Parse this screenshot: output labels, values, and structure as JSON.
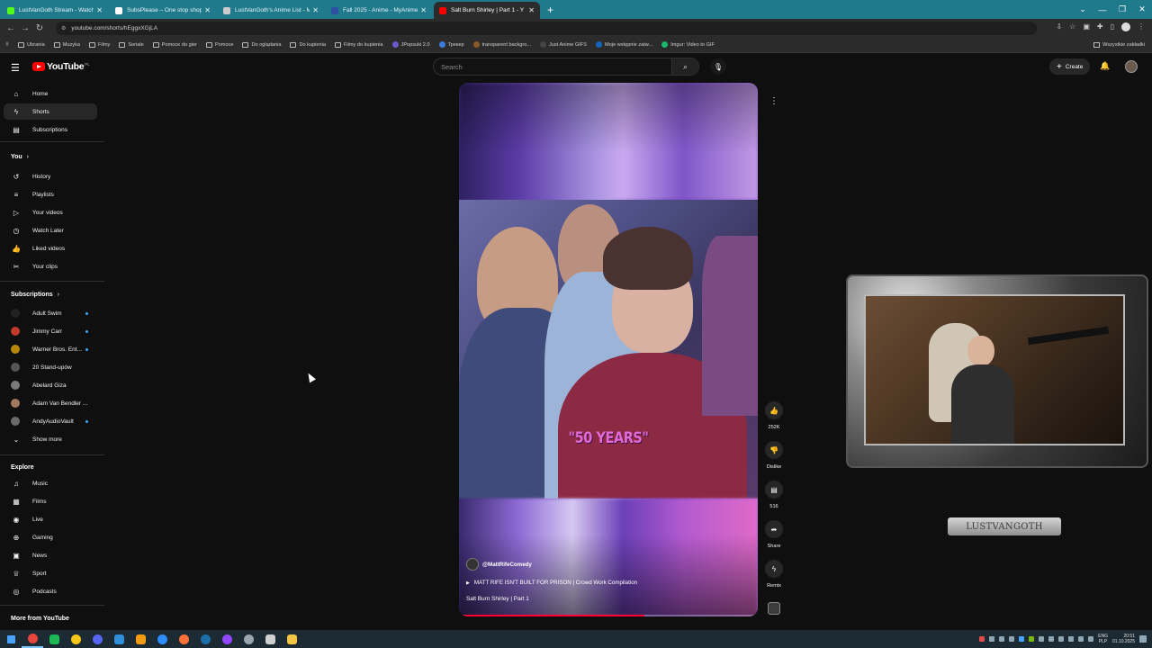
{
  "browser": {
    "tabs": [
      {
        "title": "LustVanGoth Stream - Watch L",
        "favicon_color": "#53fc18",
        "active": false
      },
      {
        "title": "SubsPlease – One stop shop fo",
        "favicon_color": "#ffffff",
        "active": false
      },
      {
        "title": "LustVanGoth's Anime List - My",
        "favicon_color": "#cccccc",
        "active": false
      },
      {
        "title": "Fall 2025 - Anime - MyAnimeLi",
        "favicon_color": "#2e51a2",
        "active": false
      },
      {
        "title": "Salt Burn Shirley | Part 1 - Y",
        "favicon_color": "#ff0000",
        "active": true
      }
    ],
    "url": "youtube.com/shorts/hEggxXGjLA",
    "bookmarks": [
      {
        "label": "Ubrania",
        "type": "folder"
      },
      {
        "label": "Muzyka",
        "type": "folder"
      },
      {
        "label": "Filmy",
        "type": "folder"
      },
      {
        "label": "Seriale",
        "type": "folder"
      },
      {
        "label": "Pomoce do gier",
        "type": "folder"
      },
      {
        "label": "Pomoce",
        "type": "folder"
      },
      {
        "label": "Do oglądania",
        "type": "folder"
      },
      {
        "label": "Do kupienia",
        "type": "folder"
      },
      {
        "label": "Filmy do kupienia",
        "type": "folder"
      },
      {
        "label": "JPopsuki 2.0",
        "type": "site",
        "color": "#6a5acd"
      },
      {
        "label": "Трекер",
        "type": "site",
        "color": "#3b7dd8"
      },
      {
        "label": "transparent backgro...",
        "type": "site",
        "color": "#8b5a2b"
      },
      {
        "label": "Just Anime GIFS",
        "type": "site",
        "color": "#444444"
      },
      {
        "label": "Moje wstępnie zatw...",
        "type": "site",
        "color": "#1565c0"
      },
      {
        "label": "Imgur: Video to GIF",
        "type": "site",
        "color": "#1bb76e"
      }
    ],
    "bookmarks_right": "Wszystkie zakładki"
  },
  "youtube": {
    "logo_text": "YouTube",
    "country_code": "PL",
    "search_placeholder": "Search",
    "create_label": "Create",
    "sidebar": {
      "main": [
        {
          "label": "Home",
          "icon": "home-icon",
          "glyph": "⌂",
          "active": false
        },
        {
          "label": "Shorts",
          "icon": "shorts-icon",
          "glyph": "ϟ",
          "active": true
        },
        {
          "label": "Subscriptions",
          "icon": "subscriptions-icon",
          "glyph": "▤",
          "active": false
        }
      ],
      "you_heading": "You",
      "you": [
        {
          "label": "History",
          "icon": "history-icon",
          "glyph": "↺"
        },
        {
          "label": "Playlists",
          "icon": "playlists-icon",
          "glyph": "≡"
        },
        {
          "label": "Your videos",
          "icon": "your-videos-icon",
          "glyph": "▷"
        },
        {
          "label": "Watch Later",
          "icon": "watch-later-icon",
          "glyph": "◷"
        },
        {
          "label": "Liked videos",
          "icon": "liked-videos-icon",
          "glyph": "👍"
        },
        {
          "label": "Your clips",
          "icon": "clips-icon",
          "glyph": "✂"
        }
      ],
      "subscriptions_heading": "Subscriptions",
      "subscriptions": [
        {
          "label": "Adult Swim",
          "color": "#222222",
          "live": true
        },
        {
          "label": "Jimmy Carr",
          "color": "#c0392b",
          "live": true
        },
        {
          "label": "Warner Bros. Ent...",
          "color": "#b8860b",
          "live": true
        },
        {
          "label": "20 Stand-upów",
          "color": "#555555",
          "live": false
        },
        {
          "label": "Abelard Giza",
          "color": "#7a7a7a",
          "live": false
        },
        {
          "label": "Adam Van Bendler ...",
          "color": "#a07a60",
          "live": false
        },
        {
          "label": "AndyAudioVault",
          "color": "#6b6b6b",
          "live": true
        }
      ],
      "show_more": "Show more",
      "explore_heading": "Explore",
      "explore": [
        {
          "label": "Music",
          "icon": "music-icon",
          "glyph": "♫"
        },
        {
          "label": "Films",
          "icon": "films-icon",
          "glyph": "▦"
        },
        {
          "label": "Live",
          "icon": "live-icon",
          "glyph": "◉"
        },
        {
          "label": "Gaming",
          "icon": "gaming-icon",
          "glyph": "⊕"
        },
        {
          "label": "News",
          "icon": "news-icon",
          "glyph": "▣"
        },
        {
          "label": "Sport",
          "icon": "sport-icon",
          "glyph": "♕"
        },
        {
          "label": "Podcasts",
          "icon": "podcasts-icon",
          "glyph": "◎"
        }
      ],
      "more_from": "More from YouTube"
    },
    "short": {
      "caption_overlay": "\"50 YEARS\"",
      "channel": "@MattRifeComedy",
      "playlist": "MATT RIFE ISN'T BUILT FOR PRISON | Crowd Work Compilation",
      "title": "Salt Burn Shirley | Part 1",
      "progress": 0.62
    },
    "actions": {
      "like_count": "252K",
      "dislike_label": "Dislike",
      "comments_count": "516",
      "share_label": "Share",
      "remix_label": "Remix"
    }
  },
  "stream_overlay": {
    "name_plate": "LUSTVANGOTH"
  },
  "taskbar": {
    "lang_top": "ENG",
    "lang_bottom": "PLP",
    "time": "20:51",
    "date": "01.10.2025"
  }
}
